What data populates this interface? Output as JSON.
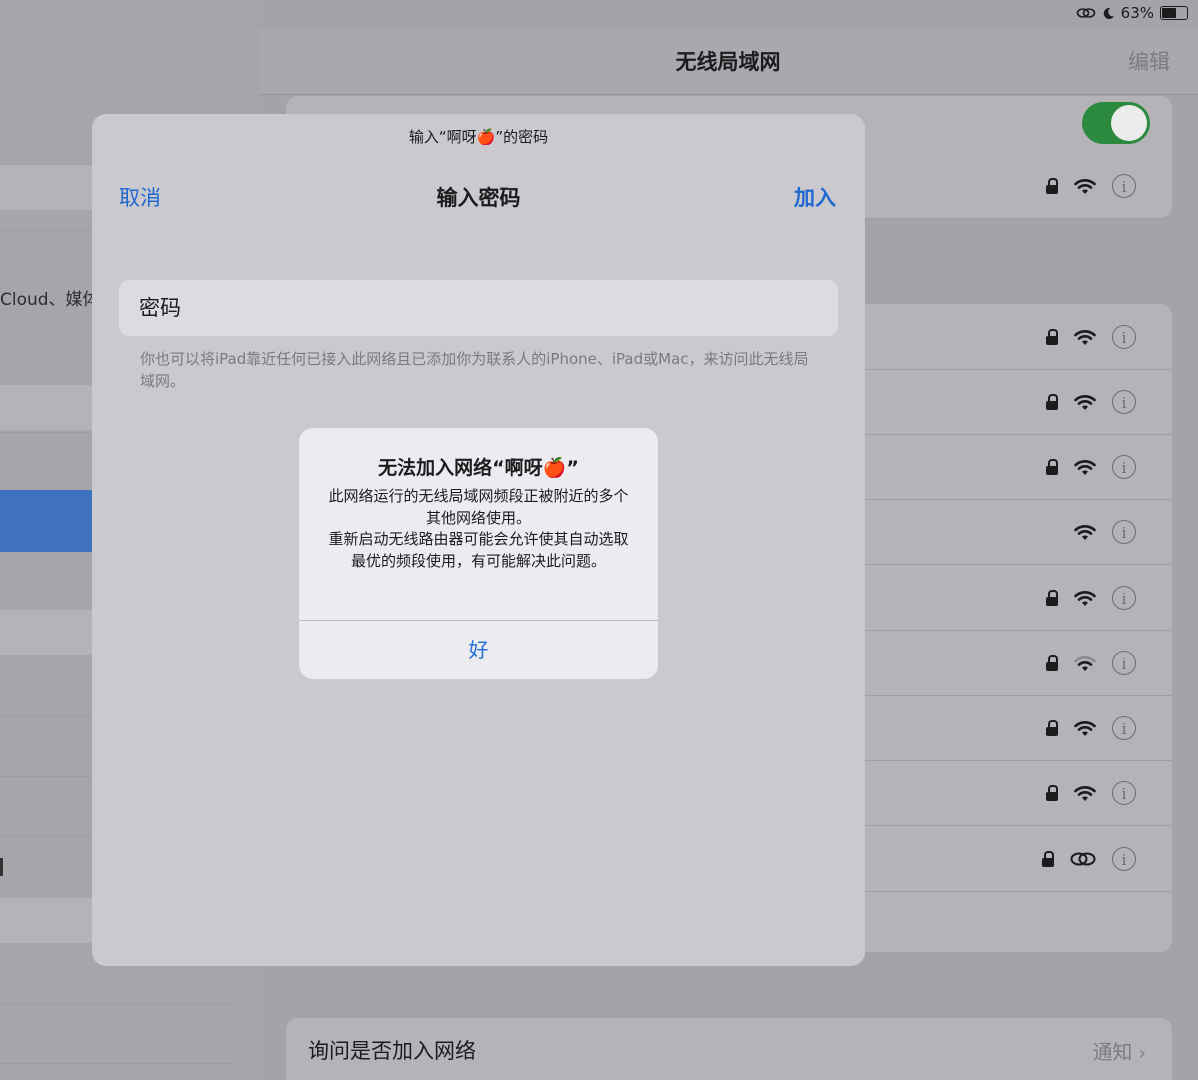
{
  "status_bar": {
    "battery_text": "63%",
    "battery_level": 0.63
  },
  "sidebar": {
    "partial_text": "Cloud、媒体"
  },
  "header": {
    "title": "无线局域网",
    "edit_label": "编辑"
  },
  "wifi_enabled": true,
  "networks": [
    {
      "secured": true,
      "signal": "full",
      "icon": "wifi-icon"
    },
    {
      "secured": true,
      "signal": "full",
      "icon": "wifi-icon"
    },
    {
      "secured": true,
      "signal": "full",
      "icon": "wifi-icon"
    },
    {
      "secured": true,
      "signal": "full",
      "icon": "wifi-icon"
    },
    {
      "secured": false,
      "signal": "full",
      "icon": "wifi-icon"
    },
    {
      "secured": true,
      "signal": "full",
      "icon": "wifi-icon"
    },
    {
      "secured": true,
      "signal": "medium",
      "icon": "wifi-icon"
    },
    {
      "secured": true,
      "signal": "full",
      "icon": "wifi-icon"
    },
    {
      "secured": true,
      "signal": "full",
      "icon": "wifi-icon"
    },
    {
      "secured": true,
      "signal": "hotspot",
      "icon": "personal-hotspot-icon"
    }
  ],
  "ask_join": {
    "label": "询问是否加入网络",
    "value": "通知"
  },
  "password_sheet": {
    "prompt": "输入“啊呀🍎”的密码",
    "cancel_label": "取消",
    "title": "输入密码",
    "join_label": "加入",
    "password_placeholder": "密码",
    "hint": "你也可以将iPad靠近任何已接入此网络且已添加你为联系人的iPhone、iPad或Mac，来访问此无线局域网。"
  },
  "alert": {
    "title": "无法加入网络“啊呀🍎”",
    "message_line1": "此网络运行的无线局域网频段正被附近的多个其他网络使用。",
    "message_line2": "重新启动无线路由器可能会允许使其自动选取最优的频段使用，有可能解决此问题。",
    "ok_label": "好"
  },
  "colors": {
    "accent": "#1f68d0",
    "toggle_on": "#2b8a3e"
  }
}
